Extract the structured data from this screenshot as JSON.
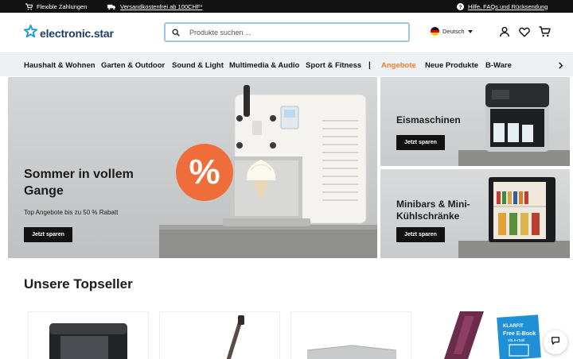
{
  "topbar": {
    "payment": "Flexible Zahlungen",
    "shipping": "Versandkostenfrei ab 100CHF*",
    "help": "Hilfe, FAQs und Rücksendung"
  },
  "header": {
    "logo": "electronic.star",
    "search_placeholder": "Produkte suchen ...",
    "language": "Deutsch"
  },
  "nav": {
    "items": [
      "Haushalt & Wohnen",
      "Garten & Outdoor",
      "Sound & Light",
      "Multimedia & Audio",
      "Sport & Fitness",
      "Angebote",
      "Neue Produkte",
      "B-Ware"
    ],
    "separator": "|"
  },
  "hero": {
    "title": "Sommer in vollem Gange",
    "subtitle": "Top Angebote bis zu 50 % Rabatt",
    "button": "Jetzt sparen",
    "badge": "%"
  },
  "promos": [
    {
      "title": "Eismaschinen",
      "button": "Jetzt sparen"
    },
    {
      "title": "Minibars & Mini-Kühlschränke",
      "button": "Jetzt sparen"
    }
  ],
  "topseller": {
    "title": "Unsere Topseller",
    "ebook_badge_brand": "KLARFIT",
    "ebook_badge_line1": "Free E-Book",
    "ebook_badge_line2": "via e-mail"
  },
  "colors": {
    "topbar": "#121212",
    "accent": "#f07d2f",
    "brand": "#1c3e63",
    "logo_star": "#1a9ad6",
    "badge": "#ef6d3a",
    "search_border": "#9ec5e6",
    "ebook_badge": "#1f8fd8"
  }
}
